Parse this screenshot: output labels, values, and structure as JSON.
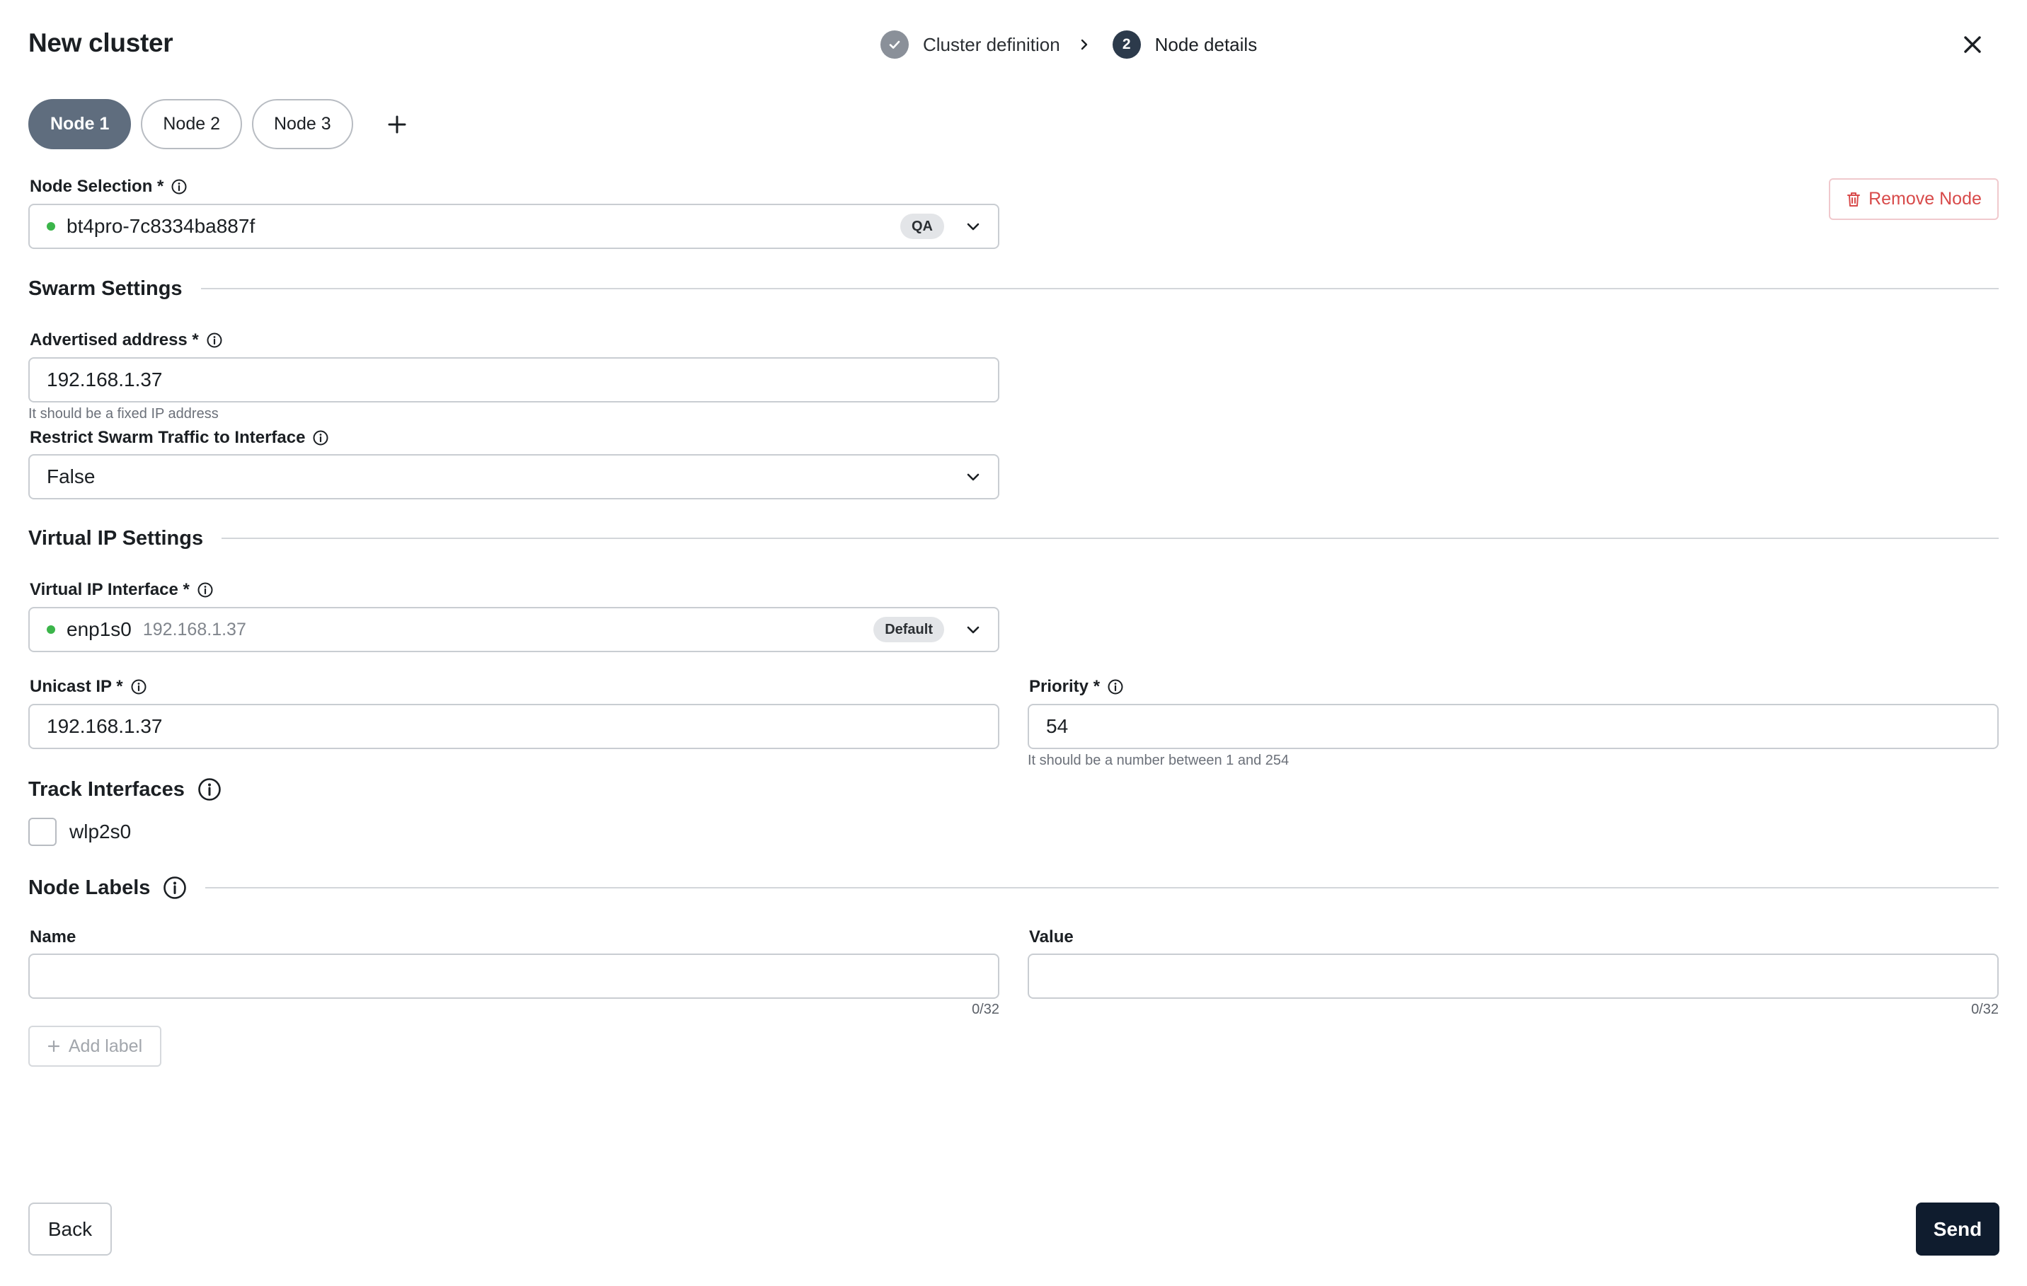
{
  "header": {
    "title": "New cluster",
    "steps": [
      {
        "number": "1",
        "label": "Cluster definition",
        "state": "completed"
      },
      {
        "number": "2",
        "label": "Node details",
        "state": "active"
      }
    ]
  },
  "tabs": [
    {
      "label": "Node 1",
      "active": true
    },
    {
      "label": "Node 2",
      "active": false
    },
    {
      "label": "Node 3",
      "active": false
    }
  ],
  "node_selection": {
    "label": "Node Selection *",
    "value": "bt4pro-7c8334ba887f",
    "badge": "QA",
    "status_color": "#3bb54a"
  },
  "remove_node": {
    "label": "Remove Node"
  },
  "swarm": {
    "title": "Swarm Settings",
    "advertised_address": {
      "label": "Advertised address *",
      "value": "192.168.1.37",
      "hint": "It should be a fixed IP address"
    },
    "restrict_traffic": {
      "label": "Restrict Swarm Traffic to Interface",
      "value": "False"
    }
  },
  "virtual_ip": {
    "title": "Virtual IP Settings",
    "interface": {
      "label": "Virtual IP Interface *",
      "value": "enp1s0",
      "secondary": "192.168.1.37",
      "badge": "Default",
      "status_color": "#3bb54a"
    },
    "unicast_ip": {
      "label": "Unicast IP *",
      "value": "192.168.1.37"
    },
    "priority": {
      "label": "Priority *",
      "value": "54",
      "hint": "It should be a number between 1 and 254"
    }
  },
  "track_interfaces": {
    "title": "Track Interfaces",
    "items": [
      {
        "label": "wlp2s0",
        "checked": false
      }
    ]
  },
  "node_labels": {
    "title": "Node Labels",
    "name": {
      "label": "Name",
      "value": "",
      "counter": "0/32"
    },
    "value": {
      "label": "Value",
      "value": "",
      "counter": "0/32"
    },
    "add_label": "Add label"
  },
  "footer": {
    "back": "Back",
    "send": "Send"
  },
  "colors": {
    "primary": "#0f1c2e",
    "tab_active": "#5f6d7e",
    "danger": "#d84a4a",
    "status_ok": "#3bb54a"
  }
}
